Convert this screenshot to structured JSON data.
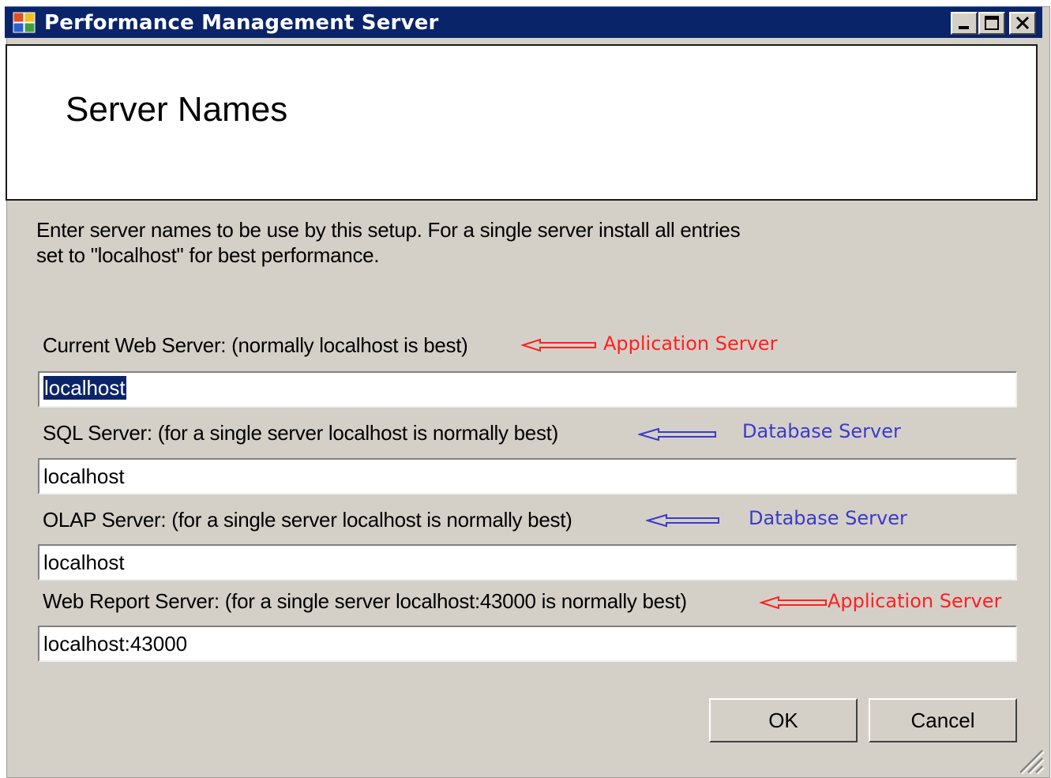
{
  "window": {
    "title": "Performance Management Server",
    "controls": {
      "minimize_icon": "minimize-icon",
      "maximize_icon": "maximize-icon",
      "close_icon": "close-icon"
    }
  },
  "header": {
    "title": "Server Names"
  },
  "instructions": {
    "line1": "Enter server names to be use by this setup.  For a single server install all entries",
    "line2": "set to \"localhost\" for best performance."
  },
  "fields": [
    {
      "label": "Current Web Server:  (normally localhost is best)",
      "value": "localhost",
      "selected": true,
      "annotation": "Application Server",
      "annotation_color": "#ff2020"
    },
    {
      "label": "SQL Server:  (for a single server localhost is normally best)",
      "value": "localhost",
      "annotation": "Database Server",
      "annotation_color": "#3a3acc"
    },
    {
      "label": "OLAP Server:  (for a single server localhost is normally best)",
      "value": "localhost",
      "annotation": "Database Server",
      "annotation_color": "#3a3acc"
    },
    {
      "label": "Web Report Server:  (for a single server localhost:43000 is normally best)",
      "value": "localhost:43000",
      "annotation": "Application Server",
      "annotation_color": "#ff2020"
    }
  ],
  "buttons": {
    "ok": "OK",
    "cancel": "Cancel"
  },
  "colors": {
    "titlebar": "#0a246a",
    "dialog_bg": "#d4d0c8",
    "selection": "#0a246a"
  }
}
